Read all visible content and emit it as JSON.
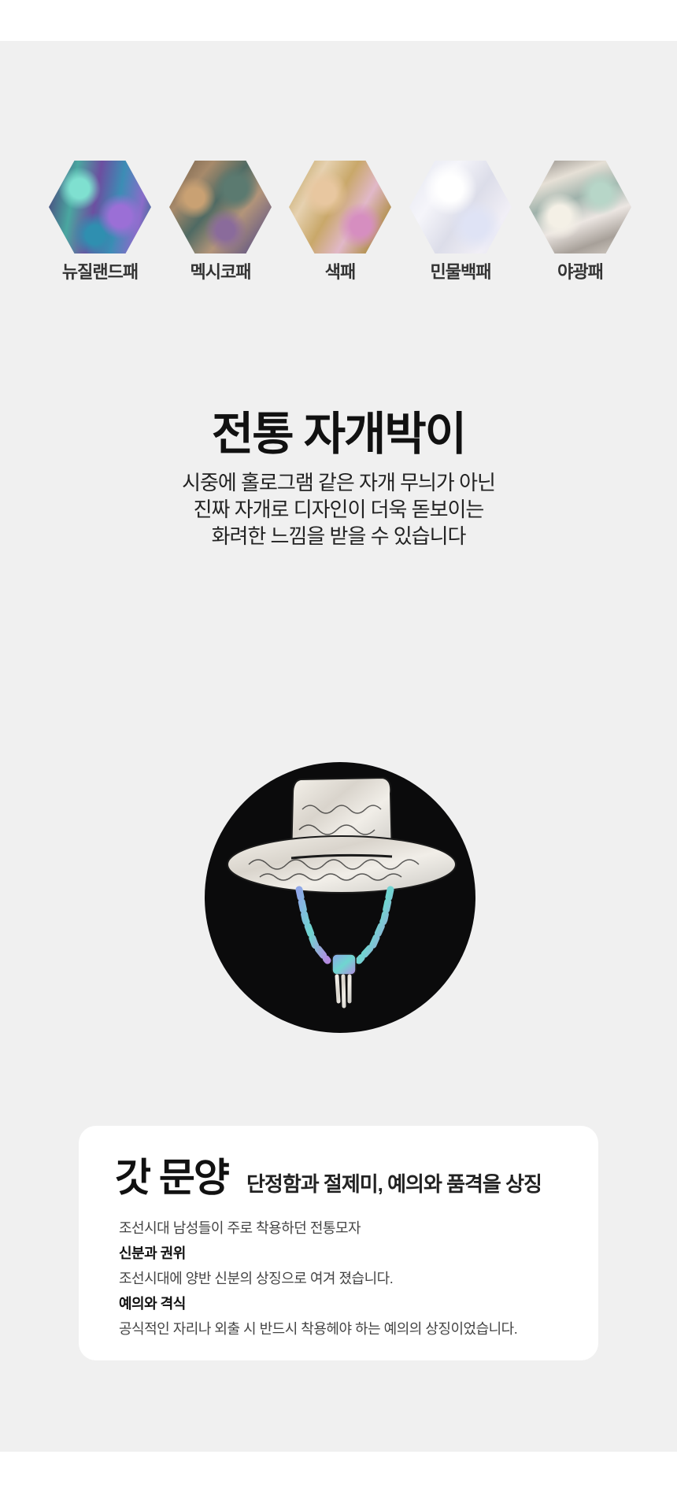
{
  "shells": [
    {
      "name": "뉴질랜드패",
      "icon": "new-zealand-shell-swatch"
    },
    {
      "name": "멕시코패",
      "icon": "mexico-shell-swatch"
    },
    {
      "name": "색패",
      "icon": "colored-shell-swatch"
    },
    {
      "name": "민물백패",
      "icon": "freshwater-white-shell-swatch"
    },
    {
      "name": "야광패",
      "icon": "luminous-shell-swatch"
    }
  ],
  "section": {
    "title": "전통 자개박이",
    "description": [
      "시중에 홀로그램 같은 자개 무늬가 아닌",
      "진짜 자개로 디자인이 더욱 돋보이는",
      "화려한 느낌을 받을 수 있습니다"
    ]
  },
  "pattern": {
    "image": "gat-hat-mother-of-pearl-medallion",
    "title": "갓 문양",
    "subtitle": "단정함과 절제미, 예의와 품격을 상징",
    "intro": "조선시대 남성들이 주로 착용하던 전통모자",
    "points": [
      {
        "heading": "신분과 권위",
        "text": "조선시대에 양반 신분의 상징으로 여겨 졌습니다."
      },
      {
        "heading": "예의와 격식",
        "text": "공식적인 자리나 외출 시 반드시 착용헤야 하는 예의의 상징이었습니다."
      }
    ]
  },
  "colors": {
    "panel_background": "#f0f0f0",
    "card_background": "#ffffff",
    "medallion_background": "#0b0b0c"
  }
}
